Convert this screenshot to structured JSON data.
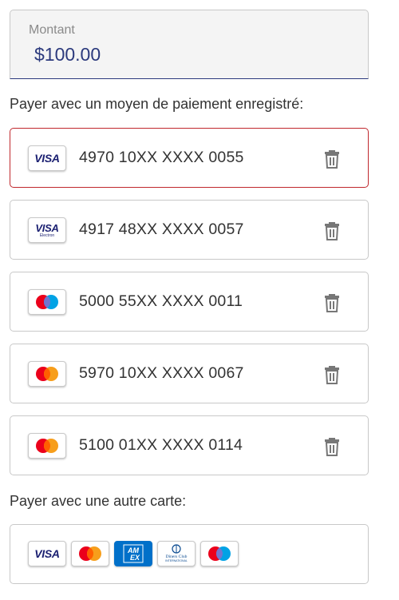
{
  "amount": {
    "label": "Montant",
    "value": "$100.00"
  },
  "saved_heading": "Payer avec un moyen de paiement enregistré:",
  "saved_cards": [
    {
      "brand": "visa",
      "number": "4970 10XX XXXX 0055",
      "selected": true
    },
    {
      "brand": "visa-electron",
      "number": "4917 48XX XXXX 0057",
      "selected": false
    },
    {
      "brand": "maestro",
      "number": "5000 55XX XXXX 0011",
      "selected": false
    },
    {
      "brand": "mastercard",
      "number": "5970 10XX XXXX 0067",
      "selected": false
    },
    {
      "brand": "mastercard",
      "number": "5100 01XX XXXX 0114",
      "selected": false
    }
  ],
  "logos": {
    "visa": "VISA",
    "visa_electron_sub": "Electron",
    "amex": "AM EX",
    "diners": "Diners Club INTERNATIONAL"
  },
  "other_heading": "Payer avec une autre carte:",
  "other_brands": [
    "visa",
    "mastercard",
    "amex",
    "diners",
    "maestro"
  ],
  "icons": {
    "delete": "trash-icon"
  },
  "colors": {
    "accent": "#2c3a7d",
    "selected_border": "#c0282d",
    "visa_blue": "#1a1f71",
    "mc_red": "#eb001b",
    "mc_orange": "#f79e1b",
    "maestro_blue": "#00a2e5",
    "amex_blue": "#0070c9",
    "icon_gray": "#777777"
  }
}
